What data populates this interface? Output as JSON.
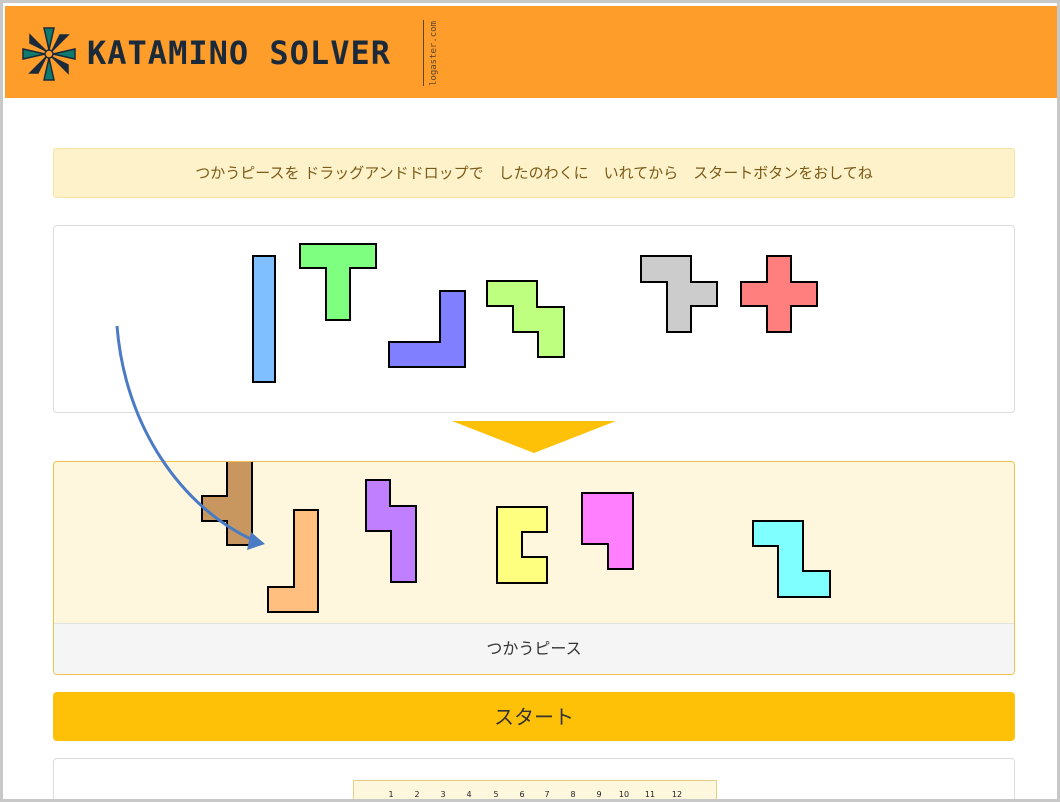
{
  "header": {
    "title": "KATAMINO SOLVER",
    "site": "logaster.com",
    "background_color": "#fe9d2a"
  },
  "notice": {
    "text": "つかうピースを ドラッグアンドドロップで　したのわくに　いれてから　スタートボタンをおしてね"
  },
  "available_pieces": [
    {
      "name": "blue-i-piece",
      "color": "#7fbfff"
    },
    {
      "name": "green-t-piece",
      "color": "#7fff7f"
    },
    {
      "name": "navy-l-piece",
      "color": "#7f7fff"
    },
    {
      "name": "lime-w-piece",
      "color": "#bfff7f"
    },
    {
      "name": "gray-piece",
      "color": "#cccccc"
    },
    {
      "name": "red-plus-piece",
      "color": "#ff7f7f"
    }
  ],
  "used_pieces": [
    {
      "name": "brown-piece",
      "color": "#c8965f"
    },
    {
      "name": "orange-l-piece",
      "color": "#ffbf7f"
    },
    {
      "name": "purple-piece",
      "color": "#bf7fff"
    },
    {
      "name": "yellow-c-piece",
      "color": "#ffff7f"
    },
    {
      "name": "magenta-piece",
      "color": "#ff7fff"
    },
    {
      "name": "cyan-z-piece",
      "color": "#7fffff"
    }
  ],
  "used_area": {
    "label": "つかうピース"
  },
  "start_button": {
    "label": "スタート",
    "color": "#ffc107"
  },
  "board": {
    "columns": [
      "1",
      "2",
      "3",
      "4",
      "5",
      "6",
      "7",
      "8",
      "9",
      "10",
      "11",
      "12"
    ]
  },
  "icons": {
    "logo": "compass-star-logo-icon",
    "arrow": "down-triangle-icon",
    "drag": "curved-arrow-icon"
  }
}
